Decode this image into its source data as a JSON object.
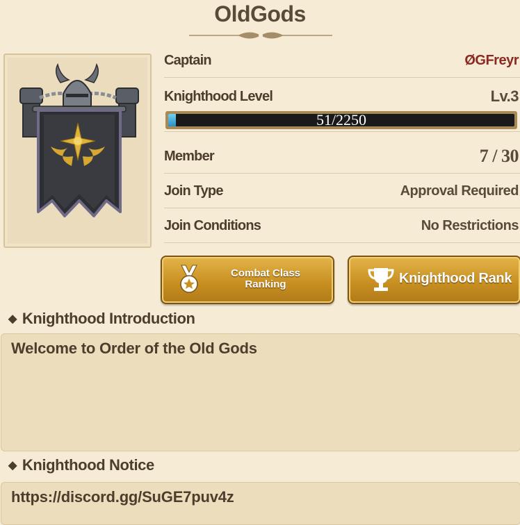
{
  "header": {
    "title": "OldGods"
  },
  "info": {
    "captain_label": "Captain",
    "captain_value": "ØGFreyr",
    "level_label": "Knighthood Level",
    "level_value": "Lv.3",
    "progress_text": "51/2250",
    "progress_fraction": 0.023,
    "member_label": "Member",
    "member_value": "7 / 30",
    "join_type_label": "Join Type",
    "join_type_value": "Approval Required",
    "join_conditions_label": "Join Conditions",
    "join_conditions_value": "No Restrictions"
  },
  "buttons": {
    "combat_line1": "Combat Class",
    "combat_line2": "Ranking",
    "rank_label": "Knighthood Rank"
  },
  "introduction": {
    "heading": "Knighthood Introduction",
    "text": "Welcome to Order of the Old Gods"
  },
  "notice": {
    "heading": "Knighthood Notice",
    "text": "https://discord.gg/SuGE7puv4z"
  },
  "icons": {
    "emblem": "knighthood-banner-emblem",
    "medal": "medal-icon",
    "trophy": "trophy-icon",
    "bullet": "diamond-bullet-icon"
  },
  "colors": {
    "background": "#f6ecd6",
    "captain_name": "#8a2a22",
    "button_gold": "#c99022",
    "progress_fill": "#2a8fc5"
  }
}
